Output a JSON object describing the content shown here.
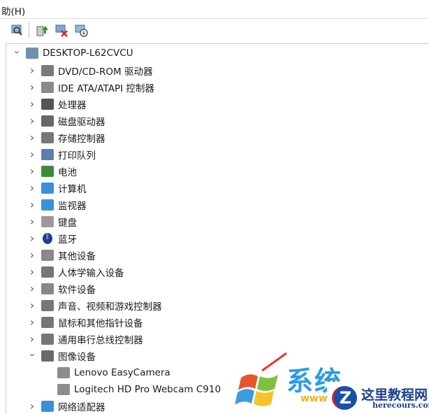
{
  "menu": {
    "help": "助(H)"
  },
  "toolbar": [
    "scan-hardware",
    "update-driver",
    "uninstall-device",
    "disable-device"
  ],
  "tree": {
    "root": "DESKTOP-L62CVCU",
    "categories": [
      {
        "label": "DVD/CD-ROM 驱动器",
        "icon": "dvd-icon",
        "color": "#7a7a7a"
      },
      {
        "label": "IDE ATA/ATAPI 控制器",
        "icon": "ide-controller-icon",
        "color": "#8a8a8a"
      },
      {
        "label": "处理器",
        "icon": "processor-icon",
        "color": "#555555"
      },
      {
        "label": "磁盘驱动器",
        "icon": "disk-drive-icon",
        "color": "#666666"
      },
      {
        "label": "存储控制器",
        "icon": "storage-controller-icon",
        "color": "#777777"
      },
      {
        "label": "打印队列",
        "icon": "printer-icon",
        "color": "#5a7fa8"
      },
      {
        "label": "电池",
        "icon": "battery-icon",
        "color": "#3c8a3c"
      },
      {
        "label": "计算机",
        "icon": "computer-icon",
        "color": "#3d8fd6"
      },
      {
        "label": "监视器",
        "icon": "monitor-icon",
        "color": "#3d8fd6"
      },
      {
        "label": "键盘",
        "icon": "keyboard-icon",
        "color": "#9a9a9a"
      },
      {
        "label": "蓝牙",
        "icon": "bluetooth-icon",
        "color": "#1b3f8f"
      },
      {
        "label": "其他设备",
        "icon": "other-devices-icon",
        "color": "#888888"
      },
      {
        "label": "人体学输入设备",
        "icon": "hid-icon",
        "color": "#777777"
      },
      {
        "label": "软件设备",
        "icon": "software-device-icon",
        "color": "#888888"
      },
      {
        "label": "声音、视频和游戏控制器",
        "icon": "sound-icon",
        "color": "#777777"
      },
      {
        "label": "鼠标和其他指针设备",
        "icon": "mouse-icon",
        "color": "#777777"
      },
      {
        "label": "通用串行总线控制器",
        "icon": "usb-icon",
        "color": "#777777"
      },
      {
        "label": "图像设备",
        "icon": "camera-icon",
        "color": "#6a6a6a",
        "expanded": true
      },
      {
        "label": "网络适配器",
        "icon": "network-icon",
        "color": "#3d8fd6"
      }
    ],
    "imaging_children": [
      "Lenovo EasyCamera",
      "Logitech HD Pro Webcam C910"
    ]
  },
  "watermark": {
    "title": "系统",
    "brand": "这里教程网",
    "url": "herecours.com",
    "www": "www"
  }
}
